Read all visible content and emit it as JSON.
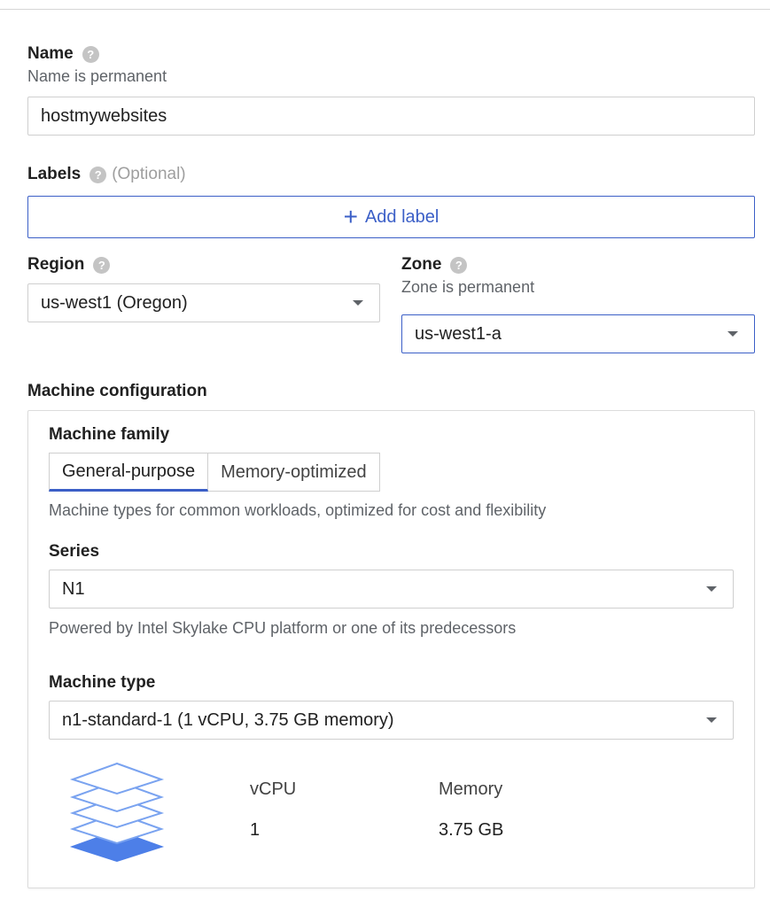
{
  "name_field": {
    "label": "Name",
    "help_icon": "help-icon",
    "note": "Name is permanent",
    "value": "hostmywebsites"
  },
  "labels_field": {
    "label": "Labels",
    "optional": "(Optional)",
    "add_button": "Add label"
  },
  "region_field": {
    "label": "Region",
    "value": "us-west1 (Oregon)"
  },
  "zone_field": {
    "label": "Zone",
    "note": "Zone is permanent",
    "value": "us-west1-a"
  },
  "machine_configuration": {
    "title": "Machine configuration",
    "family_label": "Machine family",
    "tabs": [
      {
        "label": "General-purpose",
        "active": true
      },
      {
        "label": "Memory-optimized",
        "active": false
      }
    ],
    "family_description": "Machine types for common workloads, optimized for cost and flexibility",
    "series_label": "Series",
    "series_value": "N1",
    "series_description": "Powered by Intel Skylake CPU platform or one of its predecessors",
    "machine_type_label": "Machine type",
    "machine_type_value": "n1-standard-1 (1 vCPU, 3.75 GB memory)",
    "specs": {
      "vcpu_label": "vCPU",
      "vcpu_value": "1",
      "memory_label": "Memory",
      "memory_value": "3.75 GB"
    }
  },
  "colors": {
    "accent": "#3b5fc7",
    "border": "#cfcfcf",
    "muted_text": "#5f6368"
  }
}
